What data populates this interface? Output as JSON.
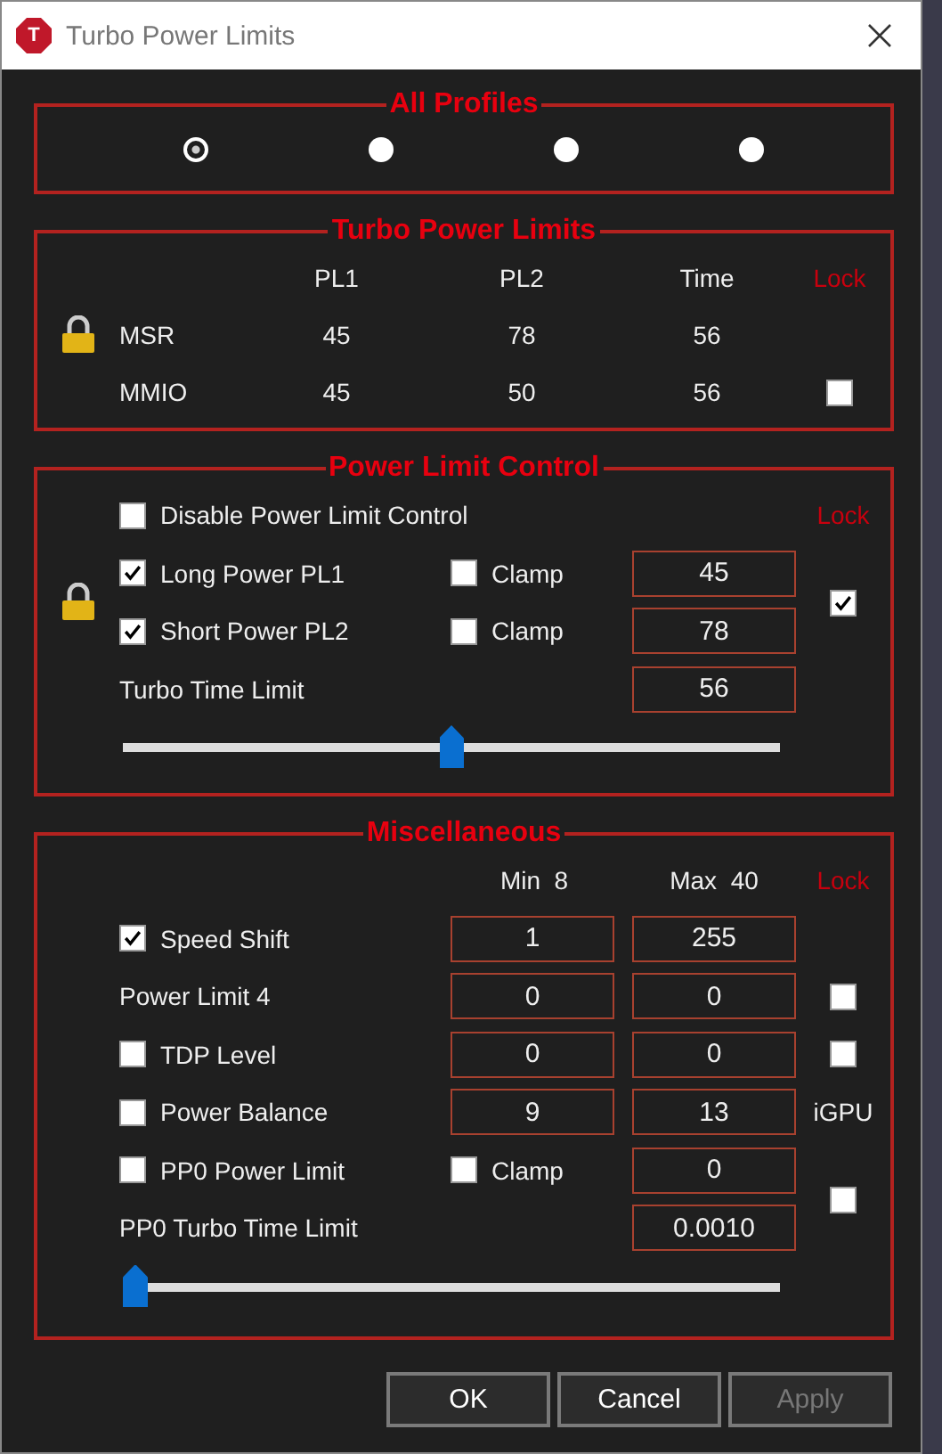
{
  "window": {
    "icon_letter": "T",
    "title": "Turbo Power Limits"
  },
  "profiles": {
    "title": "All Profiles",
    "options": [
      {
        "selected": true
      },
      {
        "selected": false
      },
      {
        "selected": false
      },
      {
        "selected": false
      }
    ]
  },
  "turbo_power_limits": {
    "title": "Turbo Power Limits",
    "columns": [
      "PL1",
      "PL2",
      "Time"
    ],
    "lock_label": "Lock",
    "rows": [
      {
        "label": "MSR",
        "values": [
          "45",
          "78",
          "56"
        ]
      },
      {
        "label": "MMIO",
        "values": [
          "45",
          "50",
          "56"
        ],
        "lock_checked": false
      }
    ]
  },
  "power_limit_control": {
    "title": "Power Limit Control",
    "lock_label": "Lock",
    "disable": {
      "label": "Disable Power Limit Control",
      "checked": false
    },
    "rows": [
      {
        "label": "Long Power PL1",
        "checked": true,
        "clamp": {
          "label": "Clamp",
          "checked": false
        },
        "value": "45"
      },
      {
        "label": "Short Power PL2",
        "checked": true,
        "clamp": {
          "label": "Clamp",
          "checked": false
        },
        "value": "78"
      }
    ],
    "lock_checked": true,
    "time_limit": {
      "label": "Turbo Time Limit",
      "value": "56"
    },
    "slider": {
      "level": 0.5
    }
  },
  "miscellaneous": {
    "title": "Miscellaneous",
    "min_label": "Min  8",
    "max_label": "Max  40",
    "lock_label": "Lock",
    "rows": [
      {
        "kind": "range",
        "label": "Speed Shift",
        "checked": true,
        "min": "1",
        "max": "255"
      },
      {
        "kind": "range",
        "label": "Power Limit 4",
        "min": "0",
        "max": "0",
        "lock_checked": false
      },
      {
        "kind": "range",
        "label": "TDP Level",
        "checked": false,
        "min": "0",
        "max": "0",
        "lock_checked": false
      },
      {
        "kind": "range",
        "label": "Power Balance",
        "checked": false,
        "min": "9",
        "max": "13",
        "side_label": "iGPU"
      },
      {
        "kind": "clamp",
        "label": "PP0 Power Limit",
        "checked": false,
        "clamp": {
          "label": "Clamp",
          "checked": false
        },
        "value": "0"
      }
    ],
    "time_limit": {
      "label": "PP0 Turbo Time Limit",
      "value": "0.0010"
    },
    "lock_checked": false,
    "slider": {
      "level": 0
    }
  },
  "buttons": [
    {
      "label": "OK",
      "disabled": false
    },
    {
      "label": "Cancel",
      "disabled": false
    },
    {
      "label": "Apply",
      "disabled": true
    }
  ]
}
